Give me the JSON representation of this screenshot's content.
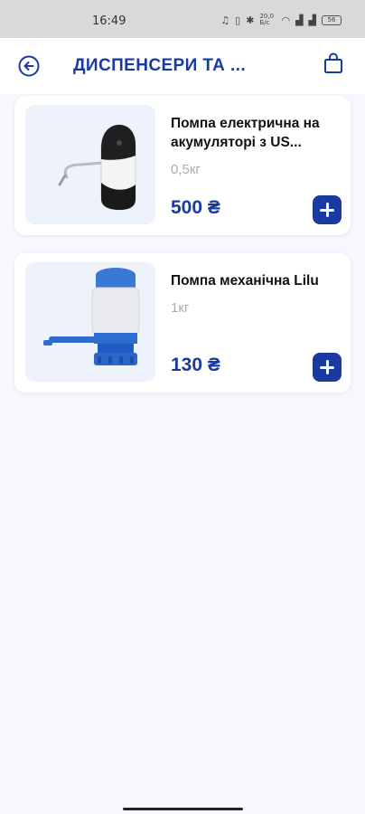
{
  "status_bar": {
    "time": "16:49",
    "network_speed": "20,0 Б/с",
    "battery": "56",
    "icons": [
      "headphones-icon",
      "vibrate-icon",
      "bluetooth-icon",
      "wifi-icon",
      "signal-icon",
      "signal-icon",
      "battery-icon"
    ]
  },
  "header": {
    "title": "ДИСПЕНСЕРИ ТА ...",
    "back_icon": "back-arrow-icon",
    "cart_icon": "shopping-bag-icon"
  },
  "products": [
    {
      "name": "Помпа електрична на акумуляторі з US...",
      "weight": "0,5кг",
      "price": "500 ₴",
      "image": "electric-pump-image"
    },
    {
      "name": "Помпа механічна Lilu",
      "weight": "1кг",
      "price": "130 ₴",
      "image": "mechanical-pump-image"
    }
  ],
  "colors": {
    "accent": "#1a3aa0",
    "background": "#f6f8fd",
    "card": "#ffffff",
    "muted_text": "#a8acb6"
  }
}
